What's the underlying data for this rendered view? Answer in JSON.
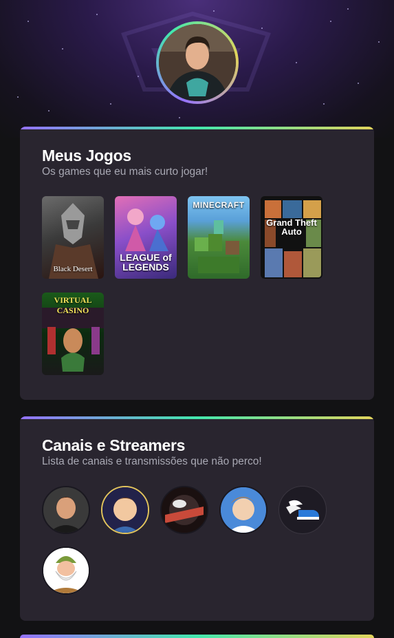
{
  "profile": {
    "avatar_icon": "profile-photo"
  },
  "games_section": {
    "title": "Meus Jogos",
    "subtitle": "Os games que eu mais curto jogar!",
    "games": [
      {
        "name": "Black Desert",
        "label": "Black Desert"
      },
      {
        "name": "League of Legends",
        "label": "LEAGUE of LEGENDS"
      },
      {
        "name": "Minecraft",
        "label": "MINECRAFT"
      },
      {
        "name": "Grand Theft Auto V",
        "label": "Grand Theft Auto"
      },
      {
        "name": "Virtual Casino",
        "label": "VIRTUAL CASINO"
      }
    ]
  },
  "channels_section": {
    "title": "Canais e Streamers",
    "subtitle": "Lista de canais e transmissões que não perco!",
    "channels": [
      {
        "icon": "streamer-1-avatar"
      },
      {
        "icon": "streamer-2-avatar"
      },
      {
        "icon": "streamer-3-avatar"
      },
      {
        "icon": "streamer-4-avatar"
      },
      {
        "icon": "winged-shoe-avatar"
      },
      {
        "icon": "dwarf-cartoon-avatar"
      }
    ]
  },
  "colors": {
    "background": "#121214",
    "card": "#29252f",
    "accent_purple": "#9572fc",
    "accent_green": "#43e7ad",
    "accent_yellow": "#e2d45c"
  }
}
